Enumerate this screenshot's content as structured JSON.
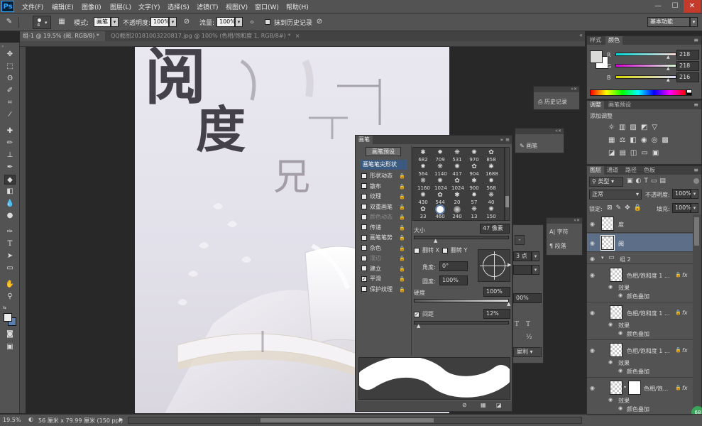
{
  "app": {
    "logo": "Ps",
    "min": "—",
    "max": "☐",
    "close": "✕"
  },
  "menu": [
    "文件(F)",
    "编辑(E)",
    "图像(I)",
    "图层(L)",
    "文字(Y)",
    "选择(S)",
    "滤镜(T)",
    "视图(V)",
    "窗口(W)",
    "帮助(H)"
  ],
  "options": {
    "size": "4",
    "mode_label": "模式:",
    "mode_value": "画笔",
    "opacity_label": "不透明度:",
    "opacity_value": "100%",
    "flow_label": "流量:",
    "flow_value": "100%",
    "history_label": "抹到历史记录",
    "workspace": "基本功能"
  },
  "tabs": [
    {
      "label": "组-1 @ 19.5% (阅, RGB/8) *",
      "close": "×"
    },
    {
      "label": "QQ截图20181003220817.jpg @ 100% (色相/饱和度 1, RGB/8#) *",
      "close": "×"
    }
  ],
  "doc_text": {
    "c1": "阅",
    "c2": "度",
    "c3": "兄"
  },
  "status": {
    "zoom": "19.5%",
    "dims": "56 厘米 x 79.99 厘米 (150 ppi)",
    "arrow": "▶"
  },
  "color_panel": {
    "tabs": [
      "样式",
      "颜色"
    ],
    "r_label": "R",
    "g_label": "G",
    "b_label": "B",
    "r": "218",
    "g": "218",
    "b": "216",
    "fg": "#dadad8",
    "bg": "#ffffff"
  },
  "adjust_panel": {
    "tabs": [
      "调整",
      "画笔预设"
    ],
    "title": "添加调整"
  },
  "history_panel": {
    "label": "历史记录"
  },
  "brush_mini": {
    "label": "画笔"
  },
  "char_panel": {
    "char": "字符",
    "para": "段落"
  },
  "brush_panel": {
    "title": "画笔",
    "preset_btn": "画笔预设",
    "tip_shape": "画笔笔尖形状",
    "cats": [
      {
        "label": "形状动态",
        "checked": false,
        "dim": false
      },
      {
        "label": "散布",
        "checked": false,
        "dim": false
      },
      {
        "label": "纹理",
        "checked": false,
        "dim": false
      },
      {
        "label": "双重画笔",
        "checked": false,
        "dim": false
      },
      {
        "label": "颜色动态",
        "checked": false,
        "dim": true
      },
      {
        "label": "传递",
        "checked": false,
        "dim": false
      },
      {
        "label": "画笔笔势",
        "checked": false,
        "dim": false
      },
      {
        "label": "杂色",
        "checked": false,
        "dim": false
      },
      {
        "label": "湿边",
        "checked": false,
        "dim": true
      },
      {
        "label": "建立",
        "checked": false,
        "dim": false
      },
      {
        "label": "平滑",
        "checked": true,
        "dim": false
      },
      {
        "label": "保护纹理",
        "checked": false,
        "dim": false
      }
    ],
    "tips": [
      [
        "682",
        "709",
        "531",
        "970",
        "858"
      ],
      [
        "564",
        "1140",
        "417",
        "904",
        "1688"
      ],
      [
        "1160",
        "1024",
        "1024",
        "900",
        "568"
      ],
      [
        "430",
        "544",
        "20",
        "57",
        "40"
      ],
      [
        "33",
        "460",
        "240",
        "13",
        "150"
      ]
    ],
    "size_label": "大小",
    "size_value": "47 像素",
    "flipx": "翻转 X",
    "flipy": "翻转 Y",
    "angle_label": "角度:",
    "angle_value": "0°",
    "round_label": "圆度:",
    "round_value": "100%",
    "hard_label": "硬度",
    "hard_value": "100%",
    "spacing_label": "间距",
    "spacing_value": "12%"
  },
  "hidden_char": {
    "pt": "3 点",
    "pct": "00%",
    "sharp": "犀利",
    "t1": "T",
    "t2": "T",
    "half": "½"
  },
  "layers_panel": {
    "tabs": [
      "图层",
      "通道",
      "路径",
      "色板"
    ],
    "filter": "类型",
    "blend": "正常",
    "opacity_label": "不透明度:",
    "opacity_value": "100%",
    "lock_label": "锁定:",
    "fill_label": "填充:",
    "fill_value": "100%",
    "layers": [
      {
        "name": "度",
        "type": "plain"
      },
      {
        "name": "阅",
        "type": "selected"
      },
      {
        "name": "组 2",
        "type": "group"
      },
      {
        "name": "色相/饱和度 1 ...",
        "type": "adj",
        "fx": "fx",
        "effect": "效果",
        "sub": "颜色叠加"
      },
      {
        "name": "色相/饱和度 1 ...",
        "type": "adj",
        "fx": "fx",
        "effect": "效果",
        "sub": "颜色叠加"
      },
      {
        "name": "色相/饱和度 1 ...",
        "type": "adj",
        "fx": "fx",
        "effect": "效果",
        "sub": "颜色叠加"
      },
      {
        "name": "色相/饱...",
        "type": "masked",
        "fx": "fx",
        "effect": "效果",
        "sub": "颜色叠加"
      }
    ],
    "badge": "68"
  }
}
